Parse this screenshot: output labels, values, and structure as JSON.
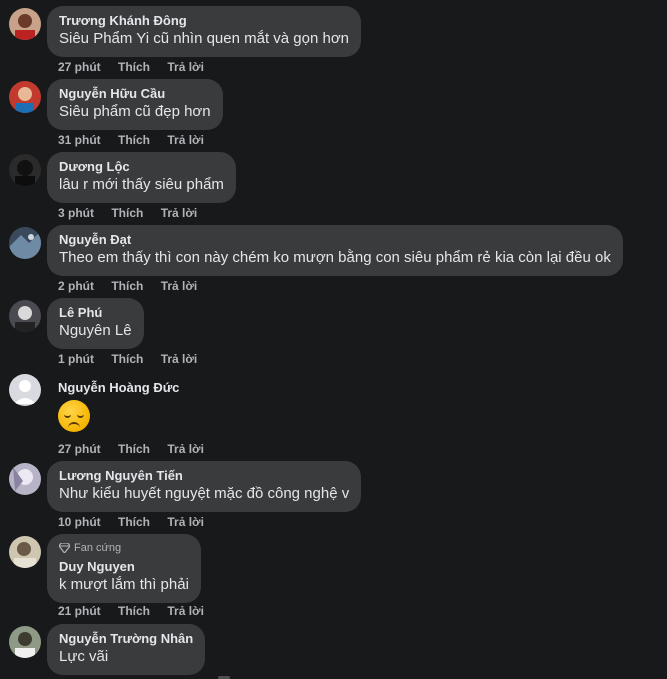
{
  "comments": [
    {
      "name": "Trương Khánh Đông",
      "text": "Siêu Phẩm Yi cũ nhìn quen mắt và gọn hơn",
      "time": "27 phút",
      "like": "Thích",
      "reply": "Trả lời"
    },
    {
      "name": "Nguyễn Hữu Cầu",
      "text": "Siêu phẩm cũ đẹp hơn",
      "time": "31 phút",
      "like": "Thích",
      "reply": "Trả lời"
    },
    {
      "name": "Dương Lộc",
      "text": "lâu r mới thấy siêu phẩm",
      "time": "3 phút",
      "like": "Thích",
      "reply": "Trả lời"
    },
    {
      "name": "Nguyễn Đạt",
      "text": "Theo em thấy thì con này chém ko mượn bằng con siêu phẩm rẻ kia còn lại đều ok",
      "time": "2 phút",
      "like": "Thích",
      "reply": "Trả lời"
    },
    {
      "name": "Lê Phú",
      "text": "Nguyên Lê",
      "time": "1 phút",
      "like": "Thích",
      "reply": "Trả lời"
    },
    {
      "name": "Nguyễn Hoàng Đức",
      "text": "",
      "emoji": "pensive-face",
      "time": "27 phút",
      "like": "Thích",
      "reply": "Trả lời"
    },
    {
      "name": "Lương Nguyên Tiến",
      "text": "Như kiểu huyết nguyệt mặc đồ công nghệ v",
      "time": "10 phút",
      "like": "Thích",
      "reply": "Trả lời"
    },
    {
      "name": "Duy Nguyen",
      "badge": "Fan cứng",
      "text": "k mượt lắm thì phải",
      "time": "21 phút",
      "like": "Thích",
      "reply": "Trả lời"
    },
    {
      "name": "Nguyễn Trường Nhân",
      "text": "Lực vãi"
    }
  ],
  "colors": {
    "background": "#18191a",
    "bubble": "#3a3b3c",
    "text": "#e4e6eb",
    "meta": "#b0b3b8"
  }
}
